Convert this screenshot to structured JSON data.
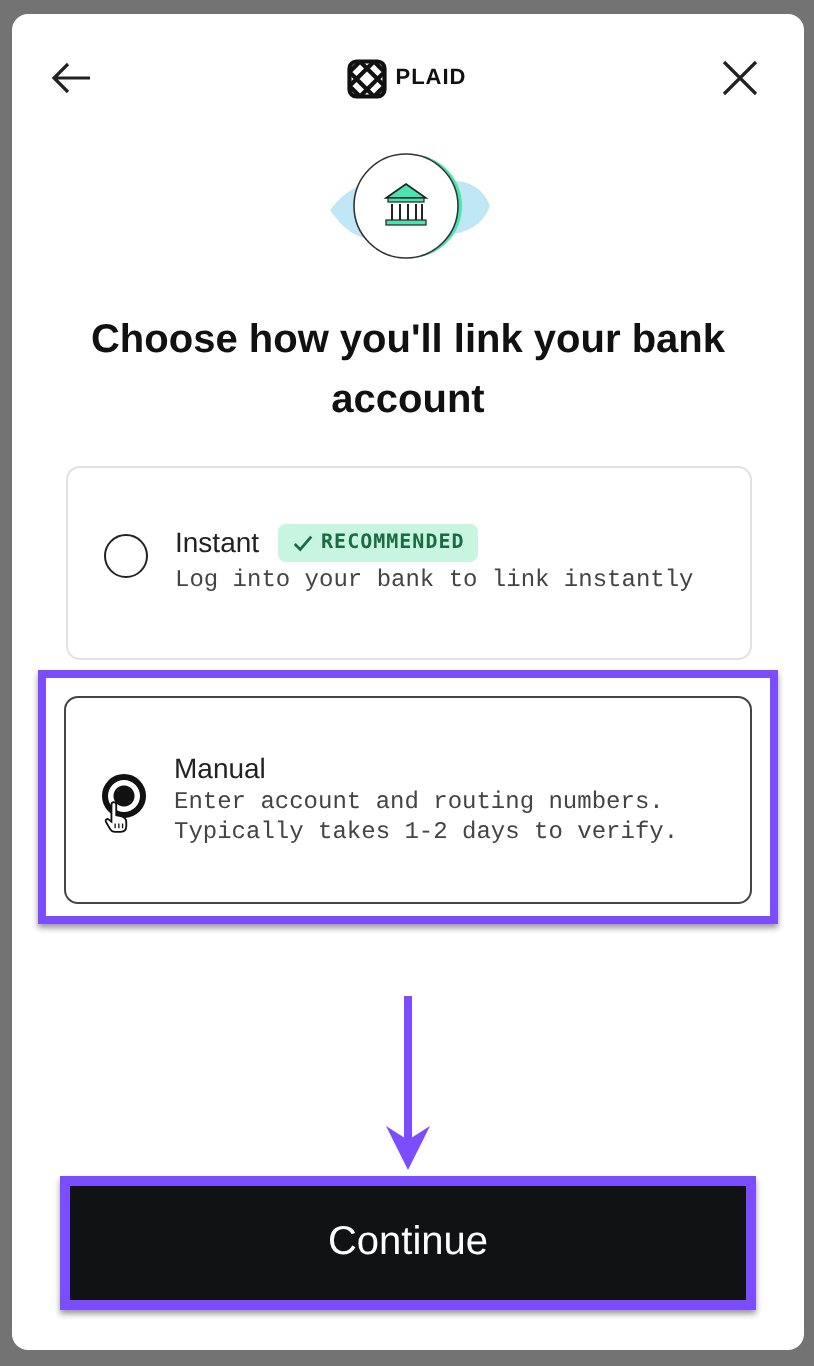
{
  "header": {
    "logo_text": "PLAID"
  },
  "title": "Choose how you'll link your bank account",
  "options": [
    {
      "title": "Instant",
      "badge": "RECOMMENDED",
      "description": "Log into your bank to link instantly",
      "selected": false,
      "highlighted": false
    },
    {
      "title": "Manual",
      "description": "Enter account and routing numbers. Typically takes 1-2 days to verify.",
      "selected": true,
      "highlighted": true
    }
  ],
  "continue_button": {
    "label": "Continue",
    "highlighted": true
  }
}
